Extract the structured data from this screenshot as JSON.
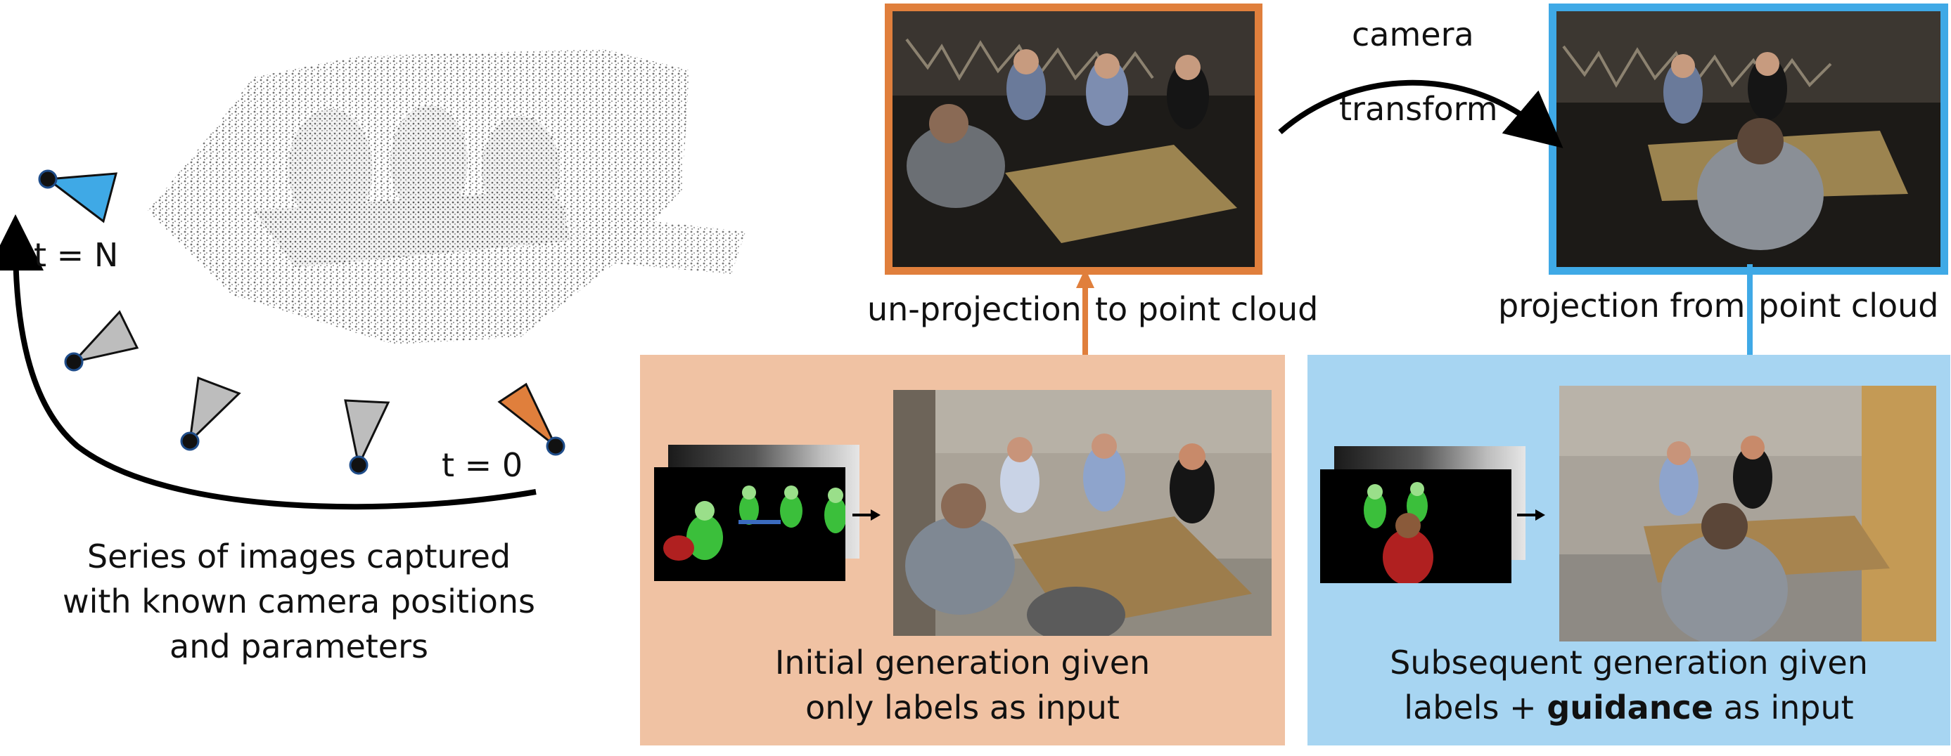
{
  "left": {
    "t_n_label": "t = N",
    "t_0_label": "t = 0",
    "caption_lines": [
      "Series of images captured",
      "with known camera positions",
      "and parameters"
    ]
  },
  "top": {
    "camera_transform_line1": "camera",
    "camera_transform_line2": "transform",
    "unprojection_part1": "un-projection",
    "unprojection_part2": "to point cloud",
    "projection_part1": "projection from",
    "projection_part2": "point cloud"
  },
  "initial_panel": {
    "caption_line1": "Initial generation given",
    "caption_line2": "only labels as input"
  },
  "subsequent_panel": {
    "caption_line1": "Subsequent generation given",
    "caption_line2_prefix": "labels + ",
    "caption_line2_bold": "guidance",
    "caption_line2_suffix": " as input"
  },
  "colors": {
    "orange": "#e07f3c",
    "orange_panel": "#f0c2a3",
    "blue": "#3fa9e6",
    "blue_panel": "#a7d5f2",
    "camera_gray": "#bdbdbd",
    "camera_blue": "#3fa9e6",
    "camera_orange": "#e07f3c"
  }
}
